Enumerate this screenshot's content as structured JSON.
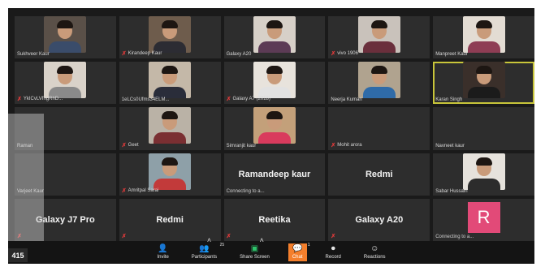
{
  "tiles": [
    {
      "name": "Sukhveer Kaur",
      "kind": "video",
      "bg": "#5a5048",
      "shirt": "#3a4c6a",
      "mic": false
    },
    {
      "name": "Kirandeep Kaur",
      "kind": "video",
      "bg": "#6e5c4c",
      "shirt": "#2c2c33",
      "mic": true
    },
    {
      "name": "Galaxy A20",
      "kind": "video",
      "bg": "#d7d0c8",
      "shirt": "#5c3b55",
      "mic": false
    },
    {
      "name": "vivo 1906",
      "kind": "video",
      "bg": "#c9c2bb",
      "shirt": "#6a2f3c",
      "mic": true
    },
    {
      "name": "Manpreet Kaur",
      "kind": "video",
      "bg": "#e3dcd3",
      "shirt": "#8e3d54",
      "mic": false
    },
    {
      "name": "YkICvLVfhgRhD...",
      "kind": "video",
      "bg": "#d9d2c9",
      "shirt": "#8a8a8a",
      "mic": true
    },
    {
      "name": "1eLCs0Ufms34ELM...",
      "kind": "video",
      "bg": "#c4b8a8",
      "shirt": "#2a2d3a",
      "mic": false
    },
    {
      "name": "Galaxy A7 (2018)",
      "kind": "video",
      "bg": "#e8e3dc",
      "shirt": "#e2e2e2",
      "mic": true
    },
    {
      "name": "Neerja Kumari",
      "kind": "video",
      "bg": "#b0a38f",
      "shirt": "#2f6ba8",
      "mic": false
    },
    {
      "name": "Karan Singh",
      "kind": "video",
      "bg": "#3a2f2a",
      "shirt": "#1b1b1b",
      "mic": false,
      "active": true
    },
    {
      "name": "Raman",
      "kind": "blank",
      "mic": false
    },
    {
      "name": "Geet",
      "kind": "video",
      "bg": "#bab2a6",
      "shirt": "#7a2f32",
      "mic": true
    },
    {
      "name": "Simranjit kaur",
      "kind": "video",
      "bg": "#c3a07a",
      "shirt": "#d93b5d",
      "mic": false
    },
    {
      "name": "Mohit arora",
      "kind": "blank",
      "mic": true
    },
    {
      "name": "Navneet kaur",
      "kind": "blank",
      "mic": false
    },
    {
      "name": "Varjeet Kaur",
      "kind": "blank",
      "mic": false
    },
    {
      "name": "Amritpal Sarai",
      "kind": "video",
      "bg": "#8ea0a8",
      "shirt": "#c23a3a",
      "mic": true
    },
    {
      "name": "Ramandeep kaur",
      "kind": "label",
      "status": "Connecting to a...",
      "mic": false
    },
    {
      "name": "Redmi",
      "kind": "label",
      "mic": false
    },
    {
      "name": "Sabar Hussain",
      "kind": "video",
      "bg": "#e6e2dc",
      "shirt": "#2c2c2c",
      "mic": false
    },
    {
      "name": "Galaxy J7 Pro",
      "kind": "label",
      "mic": true
    },
    {
      "name": "Redmi",
      "kind": "label",
      "mic": true
    },
    {
      "name": "Reetika",
      "kind": "label",
      "mic": true
    },
    {
      "name": "Galaxy A20",
      "kind": "label",
      "mic": true
    },
    {
      "name": "R",
      "kind": "avatar",
      "status": "Connecting to a...",
      "mic": false
    }
  ],
  "toolbar": {
    "invite": "Invite",
    "participants": "Participants",
    "participants_count": "25",
    "share": "Share Screen",
    "chat": "Chat",
    "chat_count": "1",
    "record": "Record",
    "reactions": "Reactions"
  },
  "counter": "415",
  "colors": {
    "active_border": "#c8c53a",
    "chat_accent": "#f47f2c",
    "avatar_pink": "#e24a78",
    "muted_mic": "#e03a3a"
  }
}
